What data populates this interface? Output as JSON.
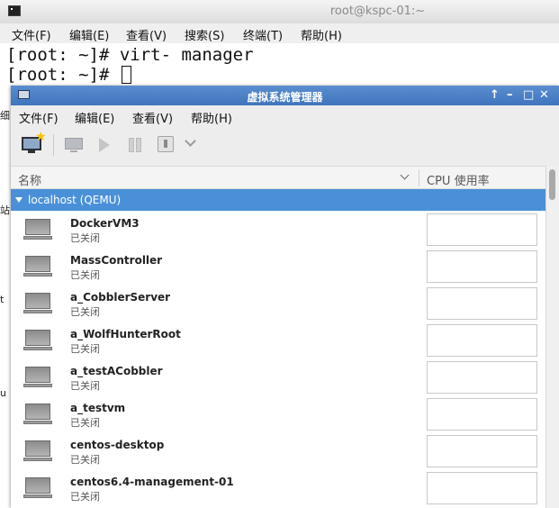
{
  "terminal": {
    "title": "root@kspc-01:~",
    "menu": [
      "文件(F)",
      "编辑(E)",
      "查看(V)",
      "搜索(S)",
      "终端(T)",
      "帮助(H)"
    ],
    "lines": [
      "[root: ~]# virt- manager",
      "[root: ~]# "
    ]
  },
  "background_edge": [
    "细",
    "站",
    "t",
    "u"
  ],
  "vm_manager": {
    "title": "虚拟系统管理器",
    "controls": {
      "pin": "↑",
      "minimize": "–",
      "maximize": "□",
      "close": "✕"
    },
    "menu": [
      "文件(F)",
      "编辑(E)",
      "查看(V)",
      "帮助(H)"
    ],
    "toolbar_icons": [
      "new-vm-icon",
      "open-console-icon",
      "run-icon",
      "pause-icon",
      "shutdown-icon",
      "shutdown-menu-chevron-icon"
    ],
    "columns": {
      "name": "名称",
      "cpu": "CPU 使用率"
    },
    "host": "localhost (QEMU)",
    "vms": [
      {
        "name": "DockerVM3",
        "status": "已关闭"
      },
      {
        "name": "MassController",
        "status": "已关闭"
      },
      {
        "name": "a_CobblerServer",
        "status": "已关闭"
      },
      {
        "name": "a_WolfHunterRoot",
        "status": "已关闭"
      },
      {
        "name": "a_testACobbler",
        "status": "已关闭"
      },
      {
        "name": "a_testvm",
        "status": "已关闭"
      },
      {
        "name": "centos-desktop",
        "status": "已关闭"
      },
      {
        "name": "centos6.4-management-01",
        "status": "已关闭"
      }
    ],
    "colors": {
      "titlebar": "#3f74bd",
      "selected_row": "#4a90d9"
    }
  }
}
